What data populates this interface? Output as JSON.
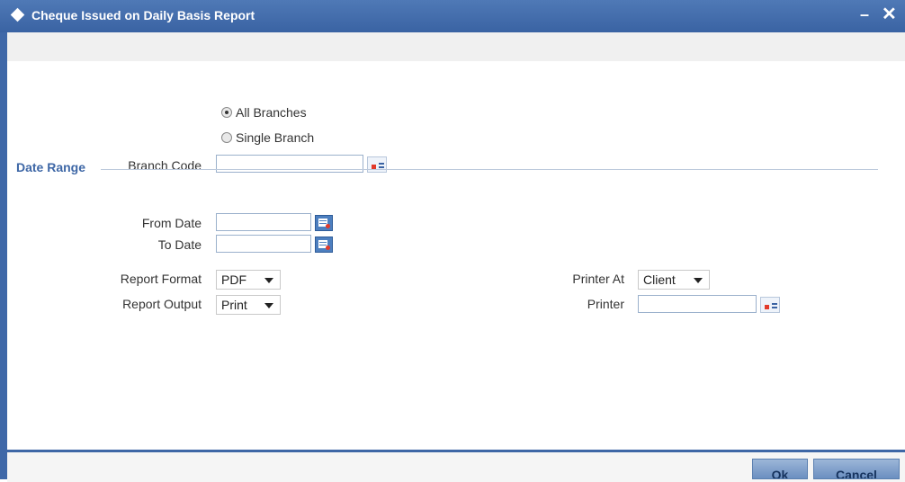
{
  "window": {
    "title": "Cheque Issued on Daily Basis Report",
    "minimize": "–",
    "close": "✕"
  },
  "branch": {
    "options": [
      {
        "label": "All Branches",
        "selected": true
      },
      {
        "label": "Single Branch",
        "selected": false
      }
    ],
    "code_label": "Branch Code",
    "code_value": ""
  },
  "date_range": {
    "section_title": "Date Range",
    "from_label": "From Date",
    "from_value": "",
    "to_label": "To Date",
    "to_value": ""
  },
  "report": {
    "format_label": "Report Format",
    "format_value": "PDF",
    "output_label": "Report Output",
    "output_value": "Print"
  },
  "printer": {
    "at_label": "Printer At",
    "at_value": "Client",
    "printer_label": "Printer",
    "printer_value": ""
  },
  "footer": {
    "ok_label": "Ok",
    "cancel_label": "Cancel"
  },
  "colors": {
    "titlebar": "#3f68a8",
    "section_title": "#3e67a6",
    "button": "#7d9cc9"
  }
}
